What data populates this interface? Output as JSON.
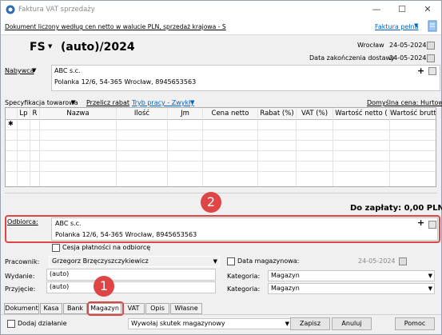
{
  "window": {
    "title": "Faktura VAT sprzedaży",
    "minimize": "—",
    "maximize": "☐",
    "close": "✕"
  },
  "infobar": {
    "text": "Dokument liczony według cen netto w walucie PLN, sprzedaż krajowa - S",
    "faktura_link": "Faktura pełna"
  },
  "header": {
    "doc_type": "FS",
    "number": "(auto)/2024",
    "place": "Wrocław",
    "date": "24-05-2024",
    "delivery_label": "Data zakończenia dostawy",
    "delivery_date": "24-05-2024"
  },
  "buyer": {
    "label": "Nabywca",
    "name": "ABC s.c.",
    "address": "Polanka 12/6, 54-365 Wrocław, 8945653563"
  },
  "spec": {
    "label": "Specyfikacja towarowa",
    "recalc": "Przelicz rabat",
    "mode": "Tryb pracy - Zwykły",
    "default_price": "Domyślna cena: Hurtowa"
  },
  "table": {
    "columns": [
      "Lp",
      "R",
      "Nazwa",
      "Ilość",
      "Jm",
      "Cena netto",
      "Rabat (%)",
      "VAT (%)",
      "Wartość netto (",
      "Wartość brutt"
    ],
    "new_row_marker": "✱"
  },
  "total": {
    "text": "Do zapłaty: 0,00 PLN"
  },
  "receiver": {
    "label": "Odbiorca:",
    "name": "ABC s.c.",
    "address": "Polanka 12/6, 54-365 Wrocław, 8945653563"
  },
  "cession": {
    "label": "Cesja płatności na odbiorcę"
  },
  "employee": {
    "label": "Pracownik:",
    "value": "Grzegorz Brzęczyszczykiewicz"
  },
  "warehouse_date": {
    "label": "Data magazynowa:",
    "value": "24-05-2024"
  },
  "issue": {
    "label": "Wydanie:",
    "value": "(auto)"
  },
  "receipt": {
    "label": "Przyjęcie:",
    "value": "(auto)"
  },
  "category1": {
    "label": "Kategoria:",
    "value": "Magazyn"
  },
  "category2": {
    "label": "Kategoria:",
    "value": "Magazyn"
  },
  "tabs": [
    "Dokument",
    "Kasa",
    "Bank",
    "Magazyn",
    "VAT",
    "Opis",
    "Własne"
  ],
  "footer": {
    "add_action": "Dodaj działanie",
    "effect": "Wywołaj skutek magazynowy",
    "save": "Zapisz",
    "cancel": "Anuluj",
    "help": "Pomoc"
  },
  "annotations": {
    "badge1": "1",
    "badge2": "2"
  }
}
